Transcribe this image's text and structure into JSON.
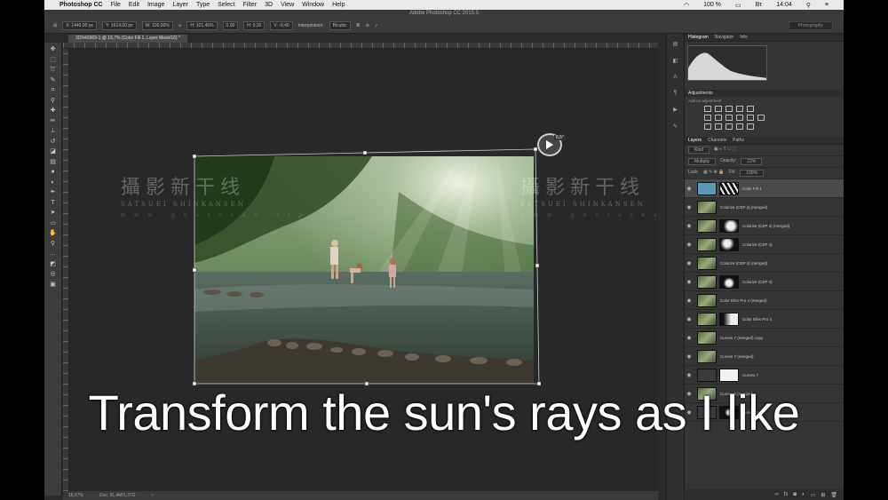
{
  "menubar": {
    "apple_icon": "apple-icon",
    "app_name": "Photoshop CC",
    "menus": [
      "File",
      "Edit",
      "Image",
      "Layer",
      "Type",
      "Select",
      "Filter",
      "3D",
      "View",
      "Window",
      "Help"
    ],
    "battery": "100 %",
    "clock_day": "Вт",
    "clock_time": "14:04"
  },
  "window": {
    "title": "Adobe Photoshop CC 2015.5"
  },
  "options": {
    "x_value": "X: 1449,00 px",
    "y_value": "Y: 1614,00 px",
    "w_value": "W: 100,00%",
    "h_value": "H: 101,45%",
    "angle": "0,00",
    "h_skew": "H: 0,00",
    "v_skew": "V: -0,40",
    "interpolation_label": "Interpolation:",
    "interpolation_value": "Bicubic",
    "workspace": "Photography"
  },
  "document": {
    "tab_title": "3DN40969-1 @ 16,7% (Color Fill 1, Layer Mask/16) *",
    "rotation_readout": "8,5°"
  },
  "status": {
    "zoom": "16,67%",
    "doc_size": "Doc: 91,4M/1,37G"
  },
  "watermark": {
    "cn": "攝影新干线",
    "en": "SATSUEI SHINKANSEN",
    "url": "w w w . p h o t o s k s . v i p"
  },
  "panels": {
    "histogram_tabs": [
      "Histogram",
      "Navigator",
      "Info"
    ],
    "adjustments_title": "Adjustments",
    "adjustments_sub": "Add an adjustment",
    "layers_tabs": [
      "Layers",
      "Channels",
      "Paths"
    ],
    "kind_label": "Kind",
    "blend_mode": "Multiply",
    "opacity_label": "Opacity:",
    "opacity_value": "22%",
    "lock_label": "Lock:",
    "fill_label": "Fill:",
    "fill_value": "100%",
    "layers": [
      {
        "name": "Color Fill 1"
      },
      {
        "name": "Colorize (CEP 4) (merged)"
      },
      {
        "name": "Colorize (CEP 4) (merged)"
      },
      {
        "name": "Colorize (CEP 4)"
      },
      {
        "name": "Colorize (CEP 4) (merged)"
      },
      {
        "name": "Colorize (CEP 4)"
      },
      {
        "name": "Color Efex Pro 4 (merged)"
      },
      {
        "name": "Color Efex Pro 4"
      },
      {
        "name": "Curves 7 (merged) copy"
      },
      {
        "name": "Curves 7 (merged)"
      },
      {
        "name": "Curves 7"
      },
      {
        "name": "Curves 6 (merged)"
      },
      {
        "name": "Curves 6"
      }
    ]
  },
  "caption": "Transform the sun's rays as I like"
}
